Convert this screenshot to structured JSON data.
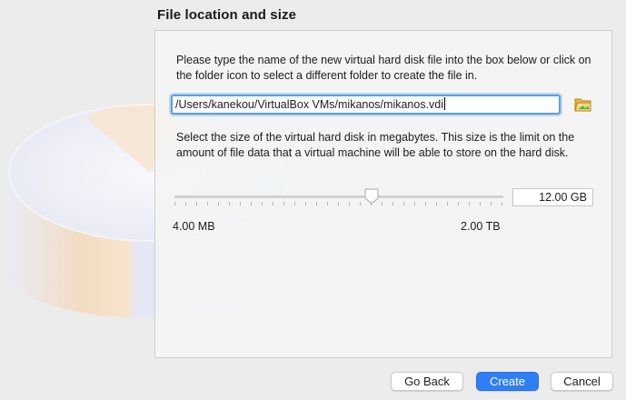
{
  "page": {
    "title": "File location and size"
  },
  "location": {
    "description": "Please type the name of the new virtual hard disk file into the box below or click on the folder icon to select a different folder to create the file in.",
    "path_value": "/Users/kanekou/VirtualBox VMs/mikanos/mikanos.vdi",
    "folder_icon": "folder-icon"
  },
  "size": {
    "description": "Select the size of the virtual hard disk in megabytes. This size is the limit on the amount of file data that a virtual machine will be able to store on the hard disk.",
    "value": "12.00 GB",
    "min_label": "4.00 MB",
    "max_label": "2.00 TB",
    "slider_position_fraction": 0.6
  },
  "buttons": {
    "back": "Go Back",
    "create": "Create",
    "cancel": "Cancel"
  },
  "colors": {
    "accent": "#2f7ef5",
    "focus_ring": "#5a9ee6"
  }
}
